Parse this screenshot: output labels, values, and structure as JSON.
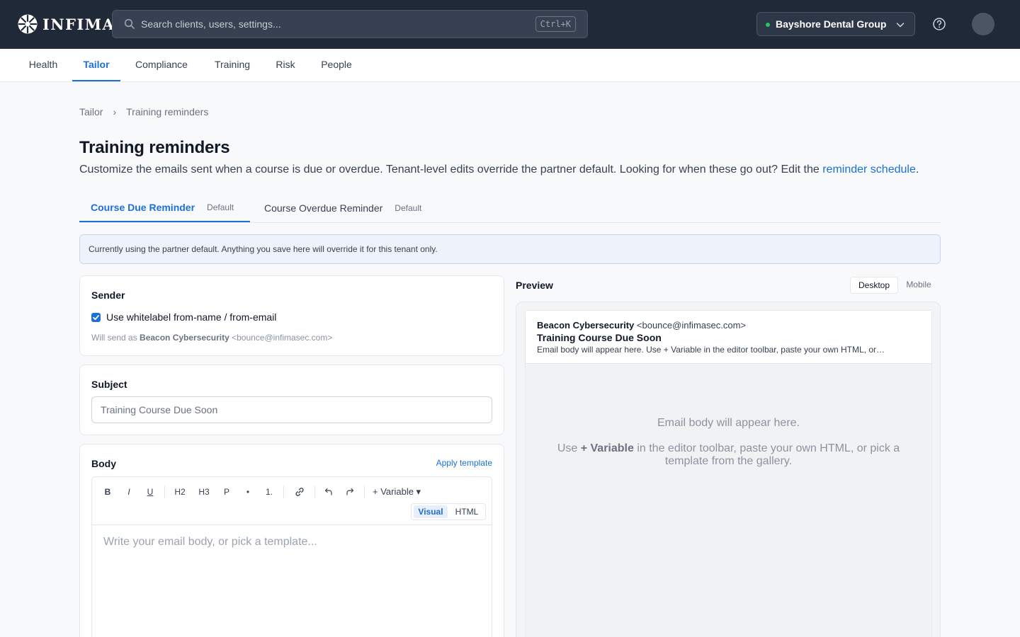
{
  "brand": {
    "name": "INFIMA"
  },
  "search": {
    "placeholder": "Search clients, users, settings...",
    "shortcut": "Ctrl+K"
  },
  "org": {
    "name": "Bayshore Dental Group",
    "status_color": "#22c55e"
  },
  "nav": {
    "tabs": [
      {
        "label": "Health"
      },
      {
        "label": "Tailor",
        "active": true
      },
      {
        "label": "Compliance"
      },
      {
        "label": "Training"
      },
      {
        "label": "Risk"
      },
      {
        "label": "People"
      }
    ]
  },
  "breadcrumb": {
    "root": "Tailor",
    "separator": "›",
    "current": "Training reminders"
  },
  "page": {
    "title": "Training reminders",
    "description": "Customize the emails sent when a course is due or overdue. Tenant-level edits override the partner default. Looking for when these go out? Edit the ",
    "description_link": "reminder schedule",
    "description_end": "."
  },
  "subtabs": [
    {
      "label": "Course Due Reminder",
      "badge": "Default",
      "active": true
    },
    {
      "label": "Course Overdue Reminder",
      "badge": "Default"
    }
  ],
  "notice": "Currently using the partner default. Anything you save here will override it for this tenant only.",
  "sender": {
    "title": "Sender",
    "checkbox_label": "Use whitelabel from-name / from-email",
    "checked": true,
    "note_prefix": "Will send as ",
    "note_name": "Beacon Cybersecurity",
    "note_email": " <bounce@infimasec.com>"
  },
  "subject": {
    "title": "Subject",
    "placeholder": "Training Course Due Soon"
  },
  "body": {
    "title": "Body",
    "apply_template": "Apply template",
    "toolbar": {
      "bold": "B",
      "italic": "I",
      "underline": "U",
      "h2": "H2",
      "h3": "H3",
      "p": "P",
      "bullet": "•",
      "ordered": "1.",
      "variable": "+ Variable ▾"
    },
    "modes": {
      "visual": "Visual",
      "html": "HTML"
    },
    "placeholder": "Write your email body, or pick a template..."
  },
  "preview": {
    "label": "Preview",
    "toggle": {
      "desktop": "Desktop",
      "mobile": "Mobile"
    },
    "from_name": "Beacon Cybersecurity",
    "from_email": " <bounce@infimasec.com>",
    "subject": "Training Course Due Soon",
    "snippet": "Email body will appear here. Use + Variable in the editor toolbar, paste your own HTML, or…",
    "body_line1": "Email body will appear here.",
    "body_line2_pre": "Use ",
    "body_line2_bold": "+ Variable",
    "body_line2_post": " in the editor toolbar, paste your own HTML, or pick a template from the gallery."
  },
  "colors": {
    "accent": "#1d6fd8",
    "topbar": "#1f2937"
  }
}
